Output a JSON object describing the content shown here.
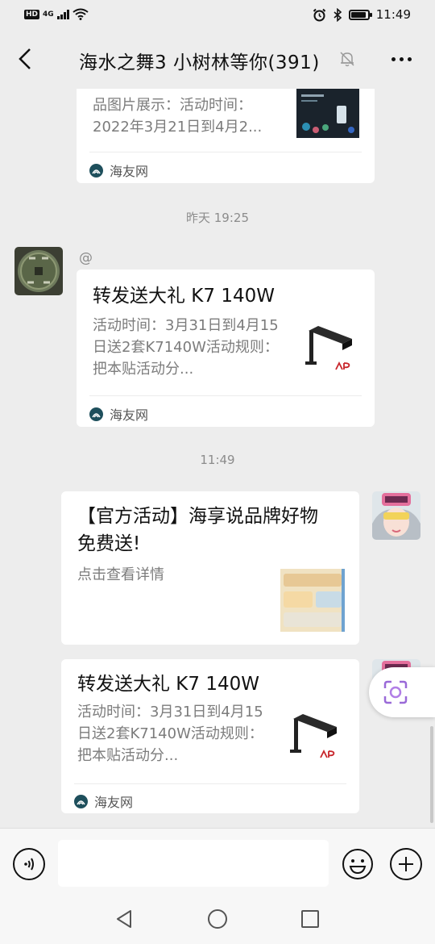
{
  "status_bar": {
    "hd_label": "HD",
    "network_label": "4G",
    "time": "11:49"
  },
  "header": {
    "title": "海水之舞3 小树林等你(391)",
    "back_icon": "back-chevron-icon",
    "mute_icon": "bell-muted-icon",
    "more_icon": "more-dots-icon"
  },
  "messages": [
    {
      "type": "link-card",
      "direction": "incoming",
      "partial": true,
      "title": "",
      "desc": "品图片展示：活动时间：2022年3月21日到4月2...",
      "source": "海友网"
    },
    {
      "type": "timestamp",
      "text": "昨天 19:25"
    },
    {
      "type": "link-card",
      "direction": "incoming",
      "sender_name": "@",
      "title": "转发送大礼 K7 140W",
      "desc": "活动时间：3月31日到4月15日送2套K7140W活动规则：把本贴活动分...",
      "source": "海友网",
      "thumb_brand": "NP"
    },
    {
      "type": "timestamp",
      "text": "11:49"
    },
    {
      "type": "link-card",
      "direction": "outgoing",
      "title": "【官方活动】海享说品牌好物免费送!",
      "desc": "点击查看详情",
      "source": ""
    },
    {
      "type": "link-card",
      "direction": "outgoing",
      "title": "转发送大礼 K7 140W",
      "desc": "活动时间：3月31日到4月15日送2套K7140W活动规则：把本贴活动分...",
      "source": "海友网",
      "thumb_brand": "NP"
    }
  ],
  "input_bar": {
    "voice_icon": "voice-icon",
    "placeholder": "",
    "emoji_icon": "emoji-icon",
    "plus_icon": "plus-icon"
  },
  "floating_button": {
    "icon": "scan-lens-icon"
  },
  "colors": {
    "background": "#ededed",
    "bubble": "#ffffff",
    "muted_text": "#7c7c7c",
    "source_icon": "#1e4f5c"
  }
}
